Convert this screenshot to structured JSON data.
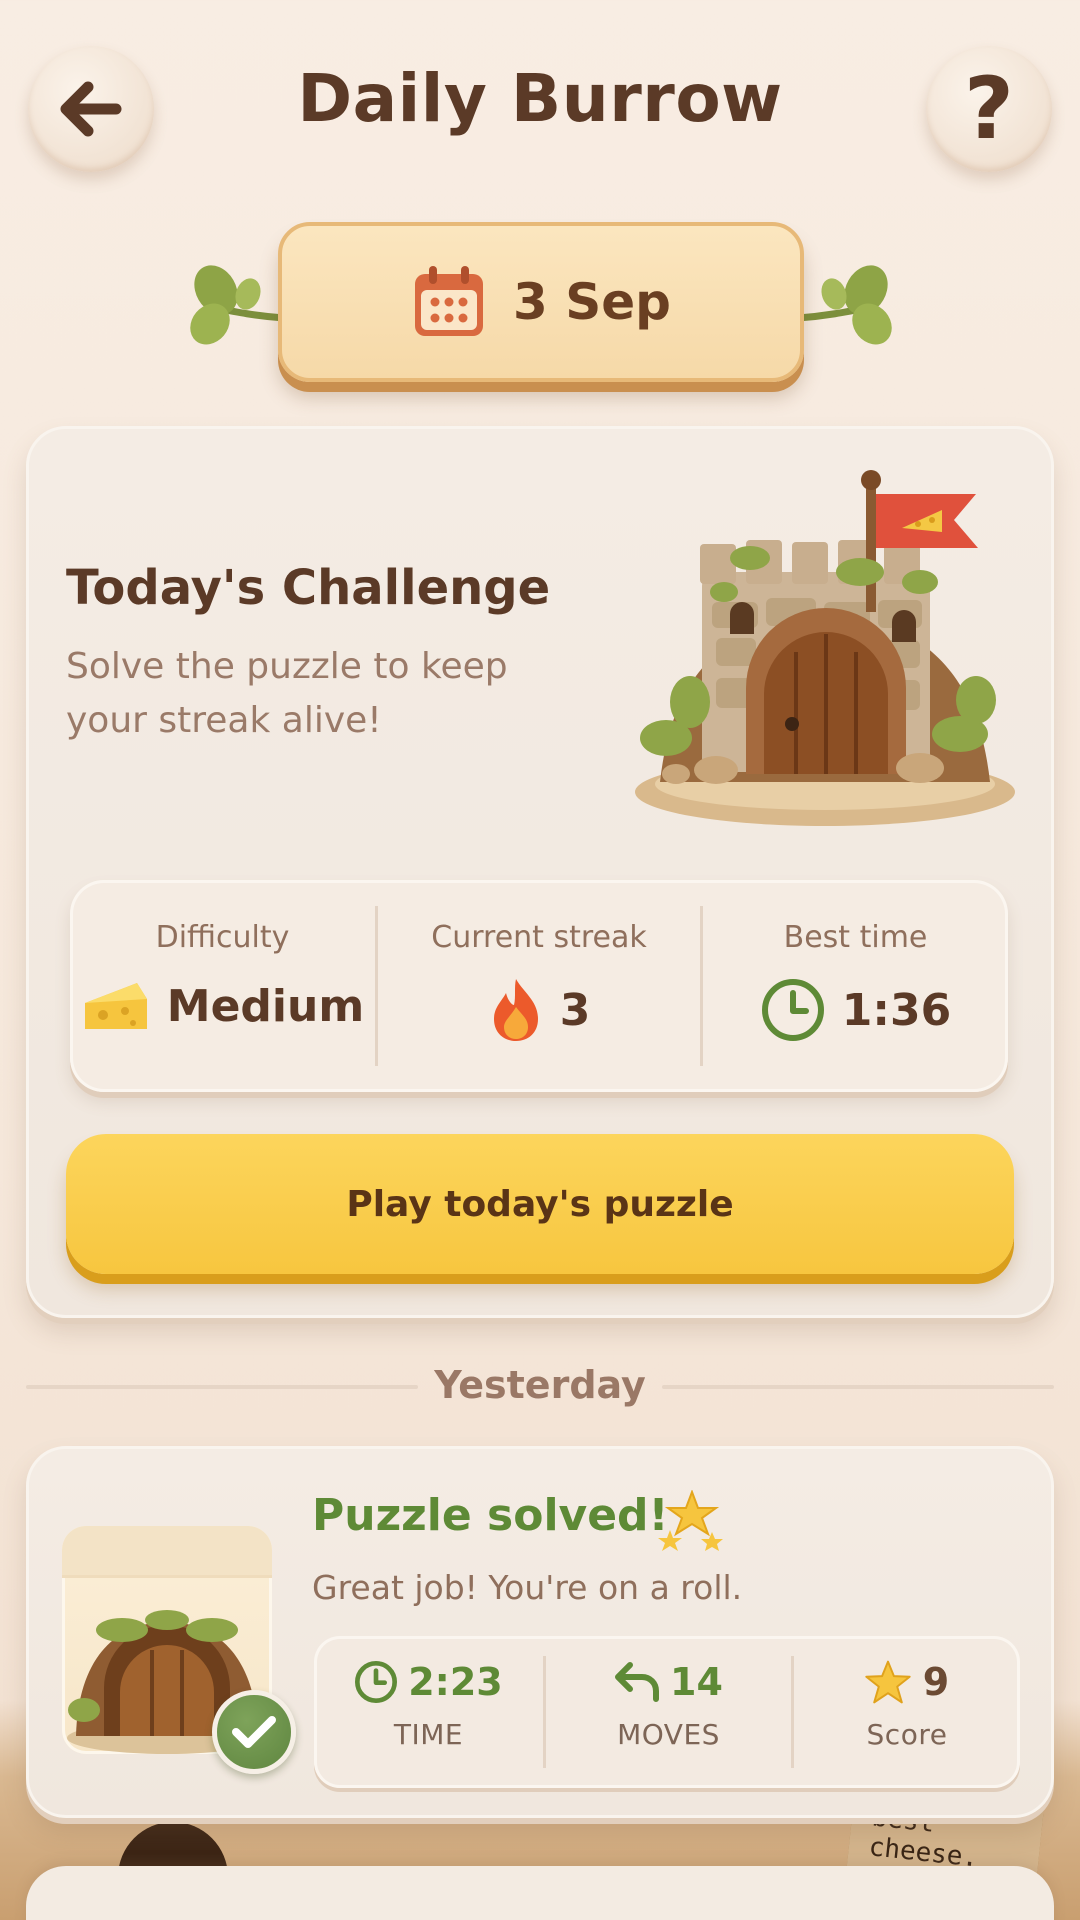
{
  "header": {
    "title": "Daily Burrow",
    "help_glyph": "?"
  },
  "date_plaque": {
    "label": "3 Sep"
  },
  "challenge": {
    "title": "Today's Challenge",
    "subtitle": "Solve the puzzle to keep your streak alive!",
    "stats": [
      {
        "label": "Difficulty",
        "value": "Medium",
        "icon": "cheese-icon"
      },
      {
        "label": "Current streak",
        "value": "3",
        "icon": "flame-icon"
      },
      {
        "label": "Best time",
        "value": "1:36",
        "icon": "clock-icon"
      }
    ],
    "play_label": "Play today's puzzle"
  },
  "section_label": "Yesterday",
  "yesterday": {
    "title": "Puzzle solved!",
    "subtitle": "Great job! You're on a roll.",
    "stats": [
      {
        "value": "2:23",
        "label": "TIME",
        "icon": "clock-icon"
      },
      {
        "value": "14",
        "label": "MOVES",
        "icon": "undo-arrow-icon"
      },
      {
        "value": "9",
        "label": "Score",
        "icon": "star-icon"
      }
    ]
  },
  "scenery": {
    "sign_text_line1": "best",
    "sign_text_line2": "cheese."
  },
  "colors": {
    "title_brown": "#5b3a27",
    "success_green": "#5e8a36",
    "play_yellow": "#f7c63f",
    "flag_red": "#e0513c"
  }
}
